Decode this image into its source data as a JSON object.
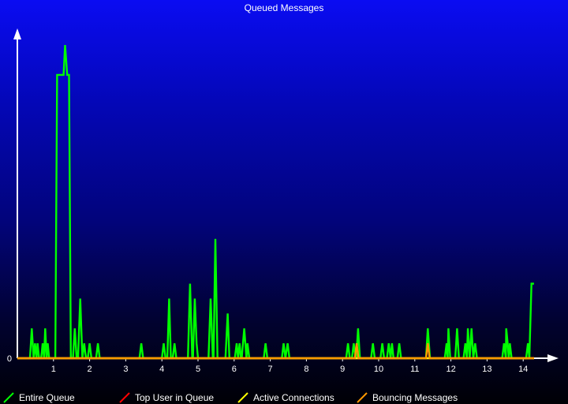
{
  "chart_data": {
    "type": "line",
    "title": "Queued Messages",
    "xlabel": "",
    "ylabel": "",
    "xlim": [
      0,
      14.8
    ],
    "ylim": [
      0,
      22
    ],
    "x_ticks": [
      1,
      2,
      3,
      4,
      5,
      6,
      7,
      8,
      9,
      10,
      11,
      12,
      13,
      14
    ],
    "y_ticks": [
      0
    ],
    "grid": false,
    "legend_position": "bottom",
    "series": [
      {
        "name": "Entire Queue",
        "color": "#00ff00",
        "points": [
          [
            0,
            0
          ],
          [
            0.25,
            0
          ],
          [
            0.35,
            0
          ],
          [
            0.4,
            2
          ],
          [
            0.45,
            0
          ],
          [
            0.49,
            1
          ],
          [
            0.53,
            0
          ],
          [
            0.56,
            1
          ],
          [
            0.6,
            0
          ],
          [
            0.66,
            0
          ],
          [
            0.7,
            1
          ],
          [
            0.74,
            0
          ],
          [
            0.77,
            2
          ],
          [
            0.81,
            0
          ],
          [
            0.84,
            1
          ],
          [
            0.88,
            0
          ],
          [
            1.05,
            0
          ],
          [
            1.1,
            19
          ],
          [
            1.28,
            19
          ],
          [
            1.32,
            21
          ],
          [
            1.38,
            19
          ],
          [
            1.43,
            19
          ],
          [
            1.48,
            0
          ],
          [
            1.54,
            0
          ],
          [
            1.59,
            2
          ],
          [
            1.64,
            0
          ],
          [
            1.68,
            0
          ],
          [
            1.74,
            4
          ],
          [
            1.8,
            0
          ],
          [
            1.85,
            1
          ],
          [
            1.9,
            0
          ],
          [
            1.95,
            0
          ],
          [
            2.0,
            1
          ],
          [
            2.05,
            0
          ],
          [
            2.18,
            0
          ],
          [
            2.23,
            1
          ],
          [
            2.28,
            0
          ],
          [
            3.38,
            0
          ],
          [
            3.43,
            1
          ],
          [
            3.48,
            0
          ],
          [
            4.0,
            0
          ],
          [
            4.05,
            1
          ],
          [
            4.1,
            0
          ],
          [
            4.15,
            0
          ],
          [
            4.2,
            4
          ],
          [
            4.25,
            0
          ],
          [
            4.3,
            0
          ],
          [
            4.35,
            1
          ],
          [
            4.4,
            0
          ],
          [
            4.72,
            0
          ],
          [
            4.78,
            5
          ],
          [
            4.84,
            0
          ],
          [
            4.86,
            0
          ],
          [
            4.91,
            4
          ],
          [
            4.96,
            1
          ],
          [
            5.0,
            0
          ],
          [
            5.29,
            0
          ],
          [
            5.35,
            4
          ],
          [
            5.41,
            0
          ],
          [
            5.43,
            0
          ],
          [
            5.48,
            8
          ],
          [
            5.54,
            0
          ],
          [
            5.76,
            0
          ],
          [
            5.82,
            3
          ],
          [
            5.87,
            0
          ],
          [
            6.02,
            0
          ],
          [
            6.07,
            1
          ],
          [
            6.11,
            0
          ],
          [
            6.15,
            1
          ],
          [
            6.19,
            0
          ],
          [
            6.21,
            0
          ],
          [
            6.28,
            2
          ],
          [
            6.34,
            0
          ],
          [
            6.37,
            1
          ],
          [
            6.42,
            0
          ],
          [
            6.82,
            0
          ],
          [
            6.87,
            1
          ],
          [
            6.92,
            0
          ],
          [
            7.32,
            0
          ],
          [
            7.37,
            1
          ],
          [
            7.42,
            0
          ],
          [
            7.48,
            1
          ],
          [
            7.53,
            0
          ],
          [
            9.1,
            0
          ],
          [
            9.15,
            1
          ],
          [
            9.2,
            0
          ],
          [
            9.26,
            0
          ],
          [
            9.31,
            1
          ],
          [
            9.36,
            0
          ],
          [
            9.38,
            0
          ],
          [
            9.43,
            2
          ],
          [
            9.48,
            0
          ],
          [
            9.79,
            0
          ],
          [
            9.84,
            1
          ],
          [
            9.89,
            0
          ],
          [
            10.05,
            0
          ],
          [
            10.1,
            1
          ],
          [
            10.15,
            0
          ],
          [
            10.23,
            0
          ],
          [
            10.28,
            1
          ],
          [
            10.33,
            0
          ],
          [
            10.37,
            1
          ],
          [
            10.41,
            0
          ],
          [
            10.52,
            0
          ],
          [
            10.57,
            1
          ],
          [
            10.62,
            0
          ],
          [
            11.31,
            0
          ],
          [
            11.36,
            2
          ],
          [
            11.42,
            0
          ],
          [
            11.83,
            0
          ],
          [
            11.88,
            1
          ],
          [
            11.91,
            0
          ],
          [
            11.93,
            2
          ],
          [
            11.98,
            0
          ],
          [
            12.12,
            0
          ],
          [
            12.17,
            2
          ],
          [
            12.22,
            0
          ],
          [
            12.35,
            0
          ],
          [
            12.4,
            1
          ],
          [
            12.44,
            0
          ],
          [
            12.47,
            2
          ],
          [
            12.52,
            0
          ],
          [
            12.57,
            2
          ],
          [
            12.62,
            0
          ],
          [
            12.67,
            1
          ],
          [
            12.72,
            0
          ],
          [
            13.42,
            0
          ],
          [
            13.47,
            1
          ],
          [
            13.52,
            0
          ],
          [
            13.53,
            2
          ],
          [
            13.57,
            1
          ],
          [
            13.6,
            0
          ],
          [
            13.63,
            1
          ],
          [
            13.68,
            0
          ],
          [
            14.08,
            0
          ],
          [
            14.13,
            1
          ],
          [
            14.17,
            0
          ],
          [
            14.23,
            5
          ],
          [
            14.3,
            5
          ]
        ]
      },
      {
        "name": "Top User in Queue",
        "color": "#ff0000",
        "points": [
          [
            0,
            0
          ],
          [
            14.3,
            0
          ]
        ]
      },
      {
        "name": "Active Connections",
        "color": "#ffff00",
        "points": [
          [
            0,
            0
          ],
          [
            14.3,
            0
          ]
        ]
      },
      {
        "name": "Bouncing Messages",
        "color": "#ff9900",
        "points": [
          [
            0,
            0
          ],
          [
            9.34,
            0
          ],
          [
            9.39,
            1
          ],
          [
            9.44,
            0
          ],
          [
            11.31,
            0
          ],
          [
            11.36,
            1
          ],
          [
            11.41,
            0
          ],
          [
            14.3,
            0
          ]
        ]
      }
    ]
  }
}
